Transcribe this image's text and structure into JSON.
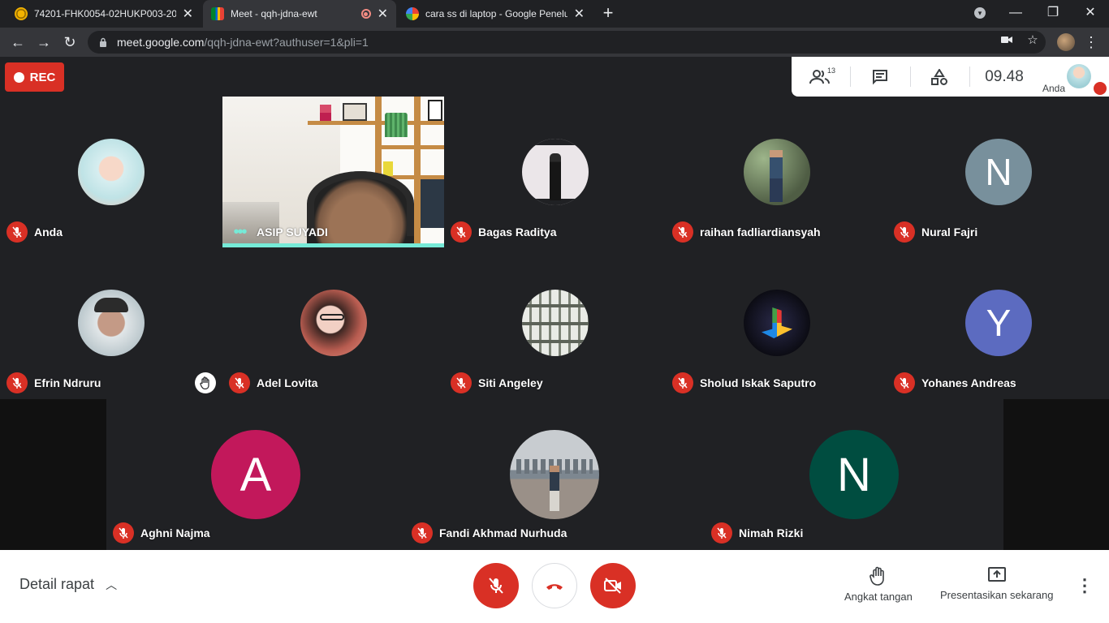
{
  "browser": {
    "tabs": [
      {
        "title": "74201-FHK0054-02HUKP003-202",
        "favicon_color": "#f4b400"
      },
      {
        "title": "Meet - qqh-jdna-ewt",
        "favicon_color": "#00897b"
      },
      {
        "title": "cara ss di laptop - Google Penelu",
        "favicon_color": "#4285f4"
      }
    ],
    "new_tab": "+",
    "window": {
      "minimize": "—",
      "restore": "❐",
      "close": "✕"
    },
    "url_host": "meet.google.com",
    "url_path": "/qqh-jdna-ewt?authuser=1&pli=1"
  },
  "meet": {
    "rec_label": "REC",
    "participant_count": "13",
    "clock": "09.48",
    "self_label": "Anda",
    "participants": [
      {
        "name": "Anda",
        "type": "photo",
        "color": "#c9e4e6"
      },
      {
        "name": "ASIP SUYADI",
        "type": "video",
        "color": "#efebe3"
      },
      {
        "name": "Bagas Raditya",
        "type": "photo",
        "color": "#e8e3e6"
      },
      {
        "name": "raihan fadliardiansyah",
        "type": "photo",
        "color": "#6f7a5e"
      },
      {
        "name": "Nural Fajri",
        "type": "letter",
        "letter": "N",
        "color": "#78909c"
      },
      {
        "name": "Efrin Ndruru",
        "type": "photo",
        "color": "#a9b6bb"
      },
      {
        "name": "Adel Lovita",
        "type": "photo",
        "color": "#b9665a"
      },
      {
        "name": "Siti Angeley",
        "type": "photo",
        "color": "#8a8f84"
      },
      {
        "name": "Sholud Iskak Saputro",
        "type": "photo",
        "color": "#1b1b2a"
      },
      {
        "name": "Yohanes Andreas",
        "type": "letter",
        "letter": "Y",
        "color": "#5c6bc0"
      },
      {
        "name": "Aghni Najma",
        "type": "letter",
        "letter": "A",
        "color": "#c2185b"
      },
      {
        "name": "Fandi Akhmad Nurhuda",
        "type": "photo",
        "color": "#9aa1a6"
      },
      {
        "name": "Nimah Rizki",
        "type": "letter",
        "letter": "N",
        "color": "#004d40"
      }
    ],
    "bottom": {
      "details_label": "Detail rapat",
      "raise_hand_label": "Angkat tangan",
      "present_label": "Presentasikan sekarang"
    }
  }
}
